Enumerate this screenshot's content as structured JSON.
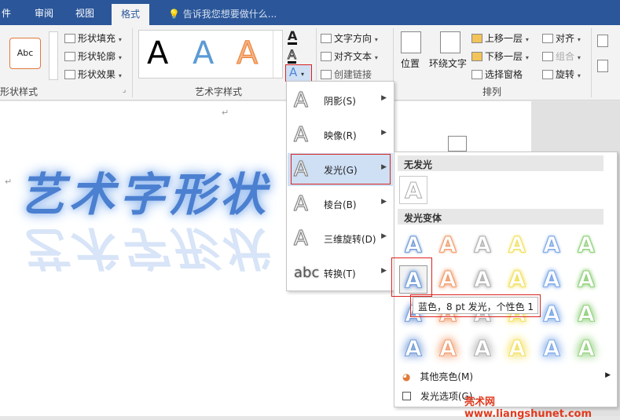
{
  "tabs": [
    "件",
    "审阅",
    "视图",
    "格式"
  ],
  "active_tab": "格式",
  "tell_me": "告诉我您想要做什么...",
  "ribbon": {
    "shape_style_sample": "Abc",
    "shape_fill": "形状填充",
    "shape_outline": "形状轮廓",
    "shape_effect": "形状效果",
    "shape_styles_group": "形状样式",
    "wordart_group": "艺术字样式",
    "text_direction": "文字方向",
    "align_text": "对齐文本",
    "create_link": "创建链接",
    "position": "位置",
    "wrap_text": "环绕文字",
    "bring_forward": "上移一层",
    "send_backward": "下移一层",
    "selection_pane": "选择窗格",
    "align": "对齐",
    "group": "组合",
    "rotate": "旋转",
    "arrange_group": "排列"
  },
  "doc": {
    "wordart_text": "艺术字形状",
    "reflection_text": "艺术字形状"
  },
  "menu": {
    "items": [
      "阴影(S)",
      "映像(R)",
      "发光(G)",
      "棱台(B)",
      "三维旋转(D)",
      "转换(T)"
    ],
    "active": "发光(G)"
  },
  "glow": {
    "no_glow": "无发光",
    "variants": "发光变体",
    "more_colors": "其他亮色(M)",
    "options": "发光选项(G)...",
    "tooltip": "蓝色，8 pt 发光，个性色 1",
    "column_colors": [
      "#6e98d6",
      "#f09a6a",
      "#b0b0b0",
      "#f2df5a",
      "#7aa6e6",
      "#8fcf7a"
    ]
  },
  "watermark": "亮术网 www.liangshunet.com"
}
